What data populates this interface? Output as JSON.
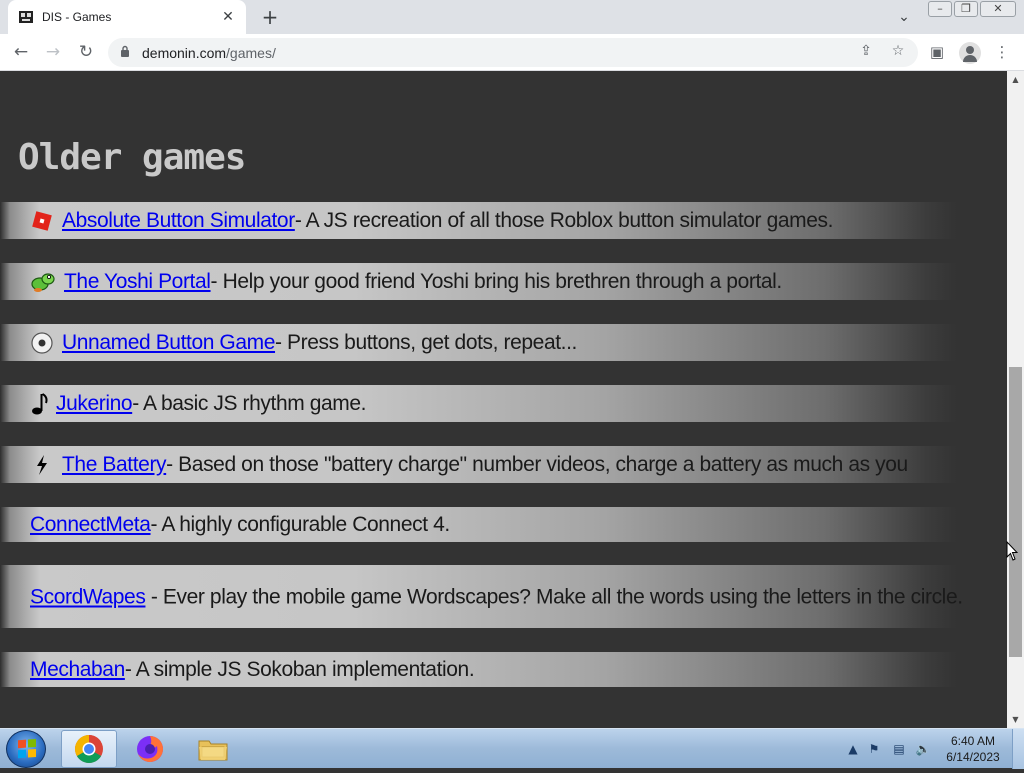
{
  "browser": {
    "tab_title": "DIS - Games",
    "tab_close": "✕",
    "new_tab": "+",
    "url_host": "demonin.com",
    "url_path": "/games/"
  },
  "page": {
    "section_title": "Older games",
    "games": [
      {
        "icon": "roblox-icon",
        "title": "Absolute Button Simulator",
        "description": " - A JS recreation of all those Roblox button simulator games."
      },
      {
        "icon": "yoshi-icon",
        "title": "The Yoshi Portal",
        "description": " - Help your good friend Yoshi bring his brethren through a portal."
      },
      {
        "icon": "dot-icon",
        "title": "Unnamed Button Game",
        "description": " - Press buttons, get dots, repeat..."
      },
      {
        "icon": "music-note-icon",
        "title": "Jukerino",
        "description": " - A basic JS rhythm game."
      },
      {
        "icon": "lightning-icon",
        "title": "The Battery",
        "description": " - Based on those \"battery charge\" number videos, charge a battery as much as you"
      },
      {
        "icon": "",
        "title": "ConnectMeta",
        "description": " - A highly configurable Connect 4."
      },
      {
        "icon": "",
        "title": "ScordWapes",
        "description": " - Ever play the mobile game Wordscapes? Make all the words using the letters in the circle."
      },
      {
        "icon": "",
        "title": "Mechaban",
        "description": " - A simple JS Sokoban implementation."
      }
    ]
  },
  "taskbar": {
    "time": "6:40 AM",
    "date": "6/14/2023"
  },
  "colors": {
    "page_bg": "#333333",
    "link": "#0000ee",
    "title": "#c9c9c9"
  }
}
